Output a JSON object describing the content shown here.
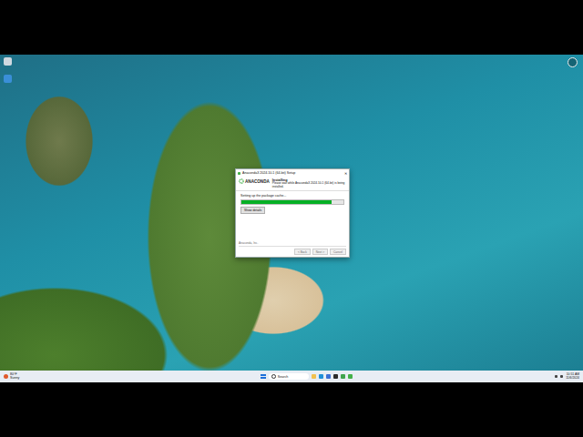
{
  "installer": {
    "title": "Anaconda3 2024.10-1 (64-bit) Setup",
    "close": "✕",
    "logo": "ANACONDA",
    "heading": "Installing",
    "subheading": "Please wait while Anaconda3 2024.10-1 (64-bit) is being installed.",
    "status": "Setting up the package cache...",
    "progress": {
      "level": 0.88
    },
    "details_button": "Show details",
    "brand": "Anaconda, Inc.",
    "buttons": [
      {
        "label": "< Back",
        "disabled": true
      },
      {
        "label": "Next >",
        "disabled": true
      },
      {
        "label": "Cancel",
        "disabled": true
      }
    ]
  },
  "taskbar": {
    "weather": {
      "temp": "80°F",
      "condition": "Sunny"
    },
    "search": {
      "placeholder": "Search"
    },
    "apps": [
      {
        "name": "explorer",
        "color": "#f2c14e"
      },
      {
        "name": "edge",
        "color": "#1f8fd8"
      },
      {
        "name": "store",
        "color": "#3b6fd6"
      },
      {
        "name": "terminal",
        "color": "#2b2b2b"
      },
      {
        "name": "chrome",
        "color": "#3fa34d"
      },
      {
        "name": "anaconda",
        "color": "#43b049"
      }
    ],
    "clock": {
      "time": "10:51 AM",
      "date": "11/6/2024"
    }
  }
}
